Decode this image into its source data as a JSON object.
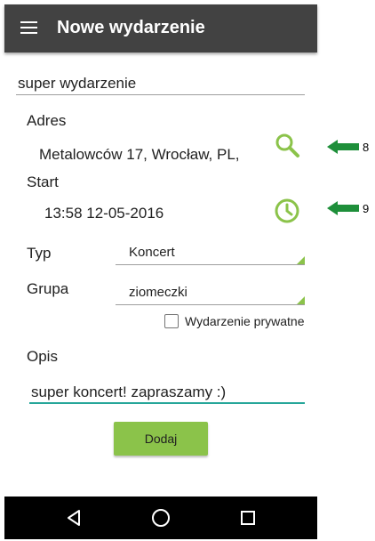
{
  "app_bar": {
    "title": "Nowe wydarzenie",
    "menu_icon": "hamburger-menu-icon"
  },
  "form": {
    "event_name": {
      "value": "super wydarzenie"
    },
    "address": {
      "label": "Adres",
      "value": "Metalowców 17, Wrocław, PL,",
      "action_icon": "search-icon"
    },
    "start": {
      "label": "Start",
      "value": "13:58 12-05-2016",
      "action_icon": "clock-icon"
    },
    "type": {
      "label": "Typ",
      "selected": "Koncert"
    },
    "group": {
      "label": "Grupa",
      "selected": "ziomeczki"
    },
    "private": {
      "label": "Wydarzenie prywatne",
      "checked": false
    },
    "description": {
      "label": "Opis",
      "value": "super koncert! zapraszamy :)"
    },
    "submit_label": "Dodaj"
  },
  "nav_bar": {
    "icons": [
      "back-icon",
      "home-icon",
      "recents-icon"
    ]
  },
  "annotations": {
    "arrow_1": "8",
    "arrow_2": "9"
  },
  "colors": {
    "app_bar": "#424242",
    "accent": "#8bc34a",
    "focus_line": "#26a69a",
    "annotation_arrow": "#1e8f3a"
  }
}
